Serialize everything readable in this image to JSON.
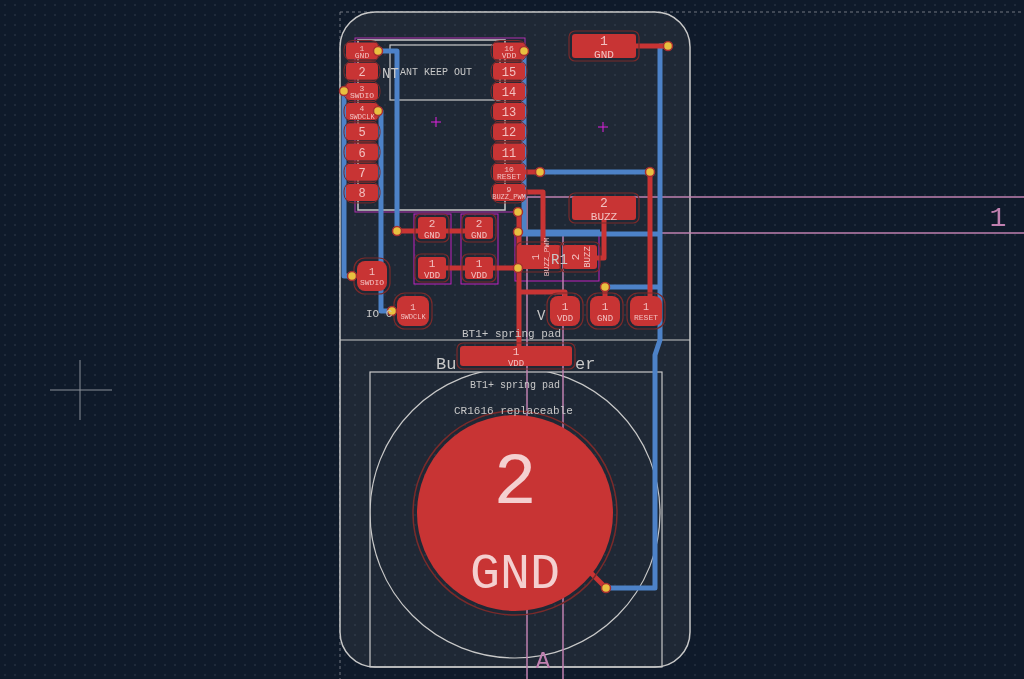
{
  "module": {
    "ant_label": "NT",
    "keepout_label": "ANT KEEP OUT",
    "left_pads": [
      {
        "number": "1",
        "net": "GND"
      },
      {
        "number": "2"
      },
      {
        "number": "3",
        "net": "SWDIO"
      },
      {
        "number": "4",
        "net": "SWDCLK"
      },
      {
        "number": "5"
      },
      {
        "number": "6"
      },
      {
        "number": "7"
      },
      {
        "number": "8"
      }
    ],
    "right_pads": [
      {
        "number": "16",
        "net": "VDD"
      },
      {
        "number": "15"
      },
      {
        "number": "14"
      },
      {
        "number": "13"
      },
      {
        "number": "12"
      },
      {
        "number": "11"
      },
      {
        "number": "10",
        "net": "RESET"
      },
      {
        "number": "9",
        "net": "BUZZ_PWM"
      }
    ]
  },
  "pads": [
    {
      "kind": "smd",
      "number": "1",
      "net": "GND"
    },
    {
      "kind": "smd",
      "number": "2",
      "net": "BUZZ"
    },
    {
      "kind": "smd",
      "number": "2",
      "net": "GND"
    },
    {
      "kind": "smd",
      "number": "1",
      "net": "VDD"
    },
    {
      "kind": "smd",
      "number": "2",
      "net": "GND"
    },
    {
      "kind": "smd",
      "number": "1",
      "net": "VDD"
    },
    {
      "kind": "smd",
      "number": "1",
      "net": "BUZZ_PWM"
    },
    {
      "kind": "smd",
      "number": "2",
      "net": "BUZZ"
    },
    {
      "kind": "test",
      "number": "1",
      "net": "SWDIO"
    },
    {
      "kind": "test",
      "number": "1",
      "net": "SWDCLK"
    },
    {
      "kind": "test",
      "number": "1",
      "net": "VDD"
    },
    {
      "kind": "test",
      "number": "1",
      "net": "GND"
    },
    {
      "kind": "test",
      "number": "1",
      "net": "RESET"
    },
    {
      "kind": "smd",
      "number": "1",
      "net": "VDD"
    },
    {
      "kind": "round",
      "number": "2",
      "net": "GND"
    }
  ],
  "silkscreen": [
    "R1",
    "IO C",
    "V",
    "BT1+ spring pad",
    "Bu",
    "er",
    "BT1+ spring pad",
    "CR1616 replaceable"
  ],
  "sheet_labels": [
    "A",
    "1"
  ]
}
